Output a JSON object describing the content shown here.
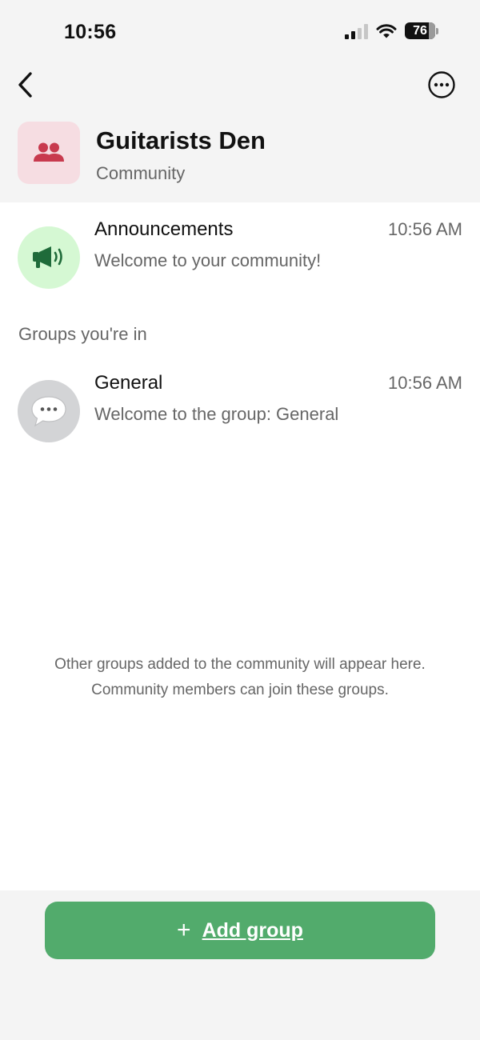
{
  "status_bar": {
    "time": "10:56",
    "battery": "76",
    "icons": [
      "signal-icon",
      "wifi-icon",
      "battery-icon"
    ]
  },
  "nav": {
    "back_icon": "chevron-left-icon",
    "more_icon": "ellipsis-circle-icon"
  },
  "community": {
    "name": "Guitarists Den",
    "subtitle": "Community",
    "icon": "people-icon",
    "avatar_color": "#f6dde2",
    "icon_color": "#c83a4e"
  },
  "announcements": {
    "name": "Announcements",
    "time": "10:56 AM",
    "message": "Welcome to your community!",
    "icon": "megaphone-icon",
    "avatar_color": "#d5f8d3",
    "icon_color": "#1f6b3a"
  },
  "groups_section": {
    "label": "Groups you're in",
    "groups": [
      {
        "name": "General",
        "time": "10:56 AM",
        "message": "Welcome to the group: General",
        "icon": "speech-bubble-icon",
        "avatar_color": "#d3d4d6"
      }
    ]
  },
  "empty_note": {
    "line1": "Other groups added to the community will appear here.",
    "line2": "Community members can join these groups."
  },
  "add_group": {
    "plus": "+",
    "label": "Add group",
    "color": "#52ab6c"
  }
}
